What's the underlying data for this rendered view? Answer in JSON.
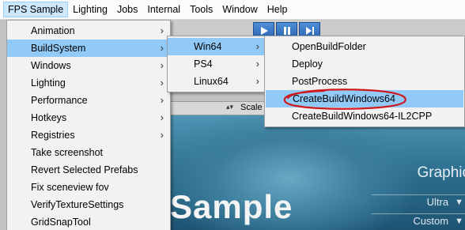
{
  "menubar": {
    "items": [
      "FPS Sample",
      "Lighting",
      "Jobs",
      "Internal",
      "Tools",
      "Window",
      "Help"
    ]
  },
  "fps_menu": {
    "items": [
      {
        "label": "Animation",
        "submenu": true
      },
      {
        "label": "BuildSystem",
        "submenu": true,
        "highlighted": true
      },
      {
        "label": "Windows",
        "submenu": true
      },
      {
        "label": "Lighting",
        "submenu": true
      },
      {
        "label": "Performance",
        "submenu": true
      },
      {
        "label": "Hotkeys",
        "submenu": true
      },
      {
        "label": "Registries",
        "submenu": true
      },
      {
        "label": "Take screenshot",
        "submenu": false
      },
      {
        "label": "Revert Selected Prefabs",
        "submenu": false
      },
      {
        "label": "Fix sceneview fov",
        "submenu": false
      },
      {
        "label": "VerifyTextureSettings",
        "submenu": false
      },
      {
        "label": "GridSnapTool",
        "submenu": false
      }
    ]
  },
  "buildsystem_menu": {
    "items": [
      {
        "label": "Win64",
        "highlighted": true
      },
      {
        "label": "PS4",
        "highlighted": false
      },
      {
        "label": "Linux64",
        "highlighted": false
      }
    ]
  },
  "win64_menu": {
    "items": [
      {
        "label": "OpenBuildFolder",
        "highlighted": false
      },
      {
        "label": "Deploy",
        "highlighted": false
      },
      {
        "label": "PostProcess",
        "highlighted": false
      },
      {
        "label": "CreateBuildWindows64",
        "highlighted": true,
        "circled": true
      },
      {
        "label": "CreateBuildWindows64-IL2CPP",
        "highlighted": false
      }
    ]
  },
  "icons": {
    "submenu_arrow": "chevron-right-icon",
    "play": "play-icon",
    "pause": "pause-icon",
    "step": "step-icon",
    "sort": "sort-arrows-icon",
    "dropdown": "caret-down-icon"
  },
  "editor": {
    "scale_label": "Scale",
    "game_title_fragment": "Sample",
    "graphics_label": "Graphic",
    "quality_value": "Ultra",
    "preset_value": "Custom"
  },
  "colors": {
    "menu_highlight": "#91c9f7",
    "menubar_active": "#cce8ff",
    "annotation_circle": "#d0191c",
    "play_button": "#2a63b0"
  }
}
